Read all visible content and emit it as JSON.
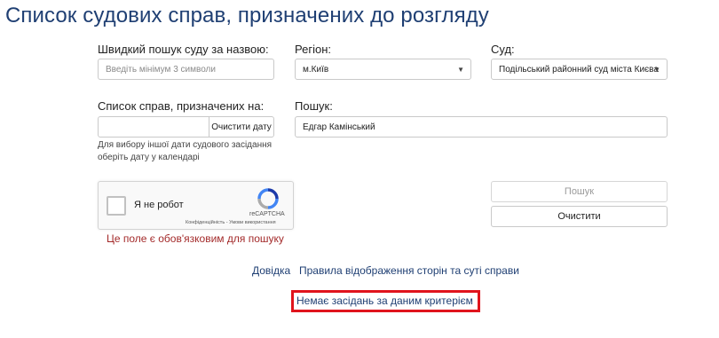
{
  "page_title": "Список судових справ, призначених до розгляду",
  "quick_search": {
    "label": "Швидкий пошук суду за назвою:",
    "placeholder": "Введіть мінімум 3 символи"
  },
  "region": {
    "label": "Регіон:",
    "value": "м.Київ"
  },
  "court": {
    "label": "Суд:",
    "value": "Подільський районний суд міста Києва"
  },
  "date_list": {
    "label": "Список справ, призначених на:",
    "value": "",
    "clear_label": "Очистити дату",
    "help": [
      "Для вибору іншої дати судового засідання",
      "оберіть дату у календарі"
    ]
  },
  "search": {
    "label": "Пошук:",
    "value": "Едгар Камінський"
  },
  "buttons": {
    "search": "Пошук",
    "clear": "Очистити"
  },
  "captcha": {
    "label": "Я не робот",
    "brand": "reCAPTCHA",
    "terms": "Конфіденційність - Умови використання"
  },
  "error": "Це поле є обов'язковим для пошуку",
  "links": {
    "help": "Довідка",
    "rules": "Правила відображення сторін та суті справи"
  },
  "result": "Немає засідань за даним критерієм",
  "colors": {
    "title": "#1f3f73",
    "error": "#a32a2a",
    "highlight": "#e0141d"
  }
}
